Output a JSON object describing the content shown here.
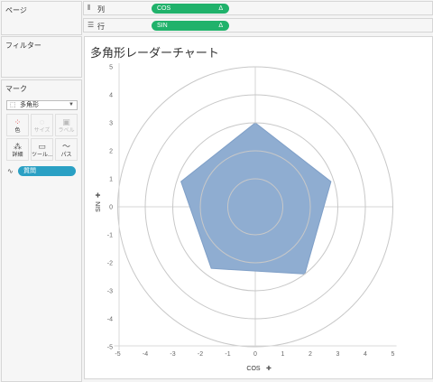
{
  "side_panels": {
    "pages_label": "ページ",
    "filters_label": "フィルター",
    "marks_label": "マーク"
  },
  "marks": {
    "mark_type": "多角形",
    "buttons": [
      {
        "label": "色",
        "icon": "color-icon",
        "enabled": true
      },
      {
        "label": "サイズ",
        "icon": "size-icon",
        "enabled": false
      },
      {
        "label": "ラベル",
        "icon": "label-icon",
        "enabled": false
      },
      {
        "label": "詳細",
        "icon": "detail-icon",
        "enabled": true
      },
      {
        "label": "ツール...",
        "icon": "tooltip-icon",
        "enabled": true
      },
      {
        "label": "パス",
        "icon": "path-icon",
        "enabled": true
      }
    ],
    "path_pill": "質問"
  },
  "shelves": {
    "columns_label": "列",
    "rows_label": "行",
    "columns_pill": "COS",
    "rows_pill": "SIN",
    "delta": "Δ"
  },
  "view": {
    "title": "多角形レーダーチャート"
  },
  "chart_data": {
    "type": "area",
    "title": "多角形レーダーチャート",
    "xlabel": "COS",
    "ylabel": "SIN",
    "xlim": [
      -5,
      5
    ],
    "ylim": [
      -5,
      5
    ],
    "xticks": [
      -5,
      -4,
      -3,
      -2,
      -1,
      0,
      1,
      2,
      3,
      4,
      5
    ],
    "yticks": [
      -5,
      -4,
      -3,
      -2,
      -1,
      0,
      1,
      2,
      3,
      4,
      5
    ],
    "rings": [
      1,
      2,
      3,
      4,
      5
    ],
    "grid": true,
    "polygon": {
      "x": [
        0,
        2.75,
        1.8,
        -1.6,
        -2.7
      ],
      "y": [
        3,
        0.9,
        -2.4,
        -2.2,
        0.9
      ]
    },
    "colors": {
      "fill": "#8fadd1",
      "stroke": "#7f9fc7",
      "grid": "#c8c8c8",
      "axis": "#d4d4d4"
    }
  }
}
